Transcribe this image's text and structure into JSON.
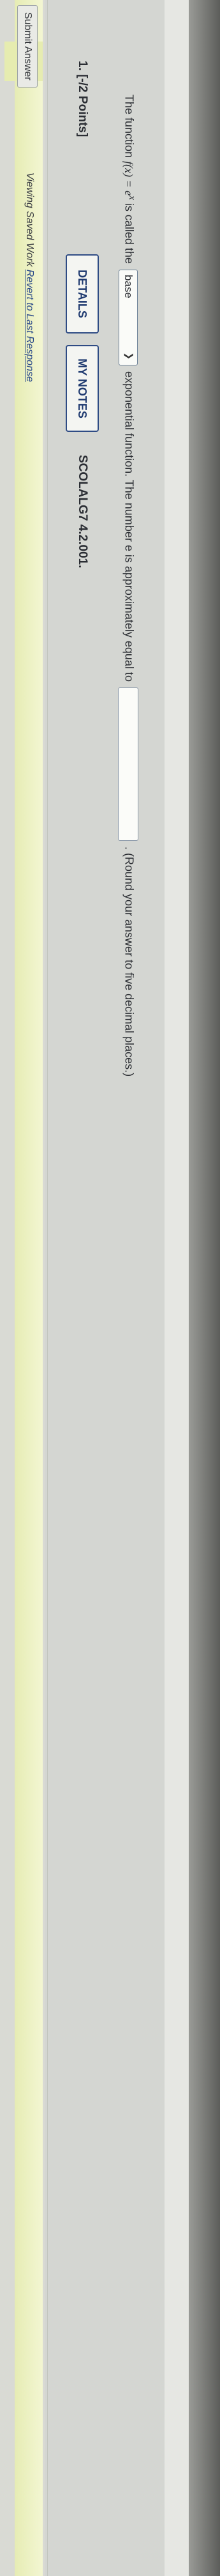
{
  "question": {
    "number": "1.",
    "points": "[-/2 Points]",
    "details_label": "DETAILS",
    "notes_label": "MY NOTES",
    "code": "SCOLALG7 4.2.001."
  },
  "prompt": {
    "part1": "The function",
    "function_text": "f(x) = e",
    "function_exp": "x",
    "part2": "is called the",
    "select_value": "base",
    "part3": "exponential function. The number e is approximately equal to",
    "answer_value": "",
    "part4": ". (Round your answer to five decimal places.)"
  },
  "footer": {
    "viewing_label": "Viewing Saved Work",
    "revert_link": "Revert to Last Response",
    "submit_label": "Submit Answer"
  }
}
